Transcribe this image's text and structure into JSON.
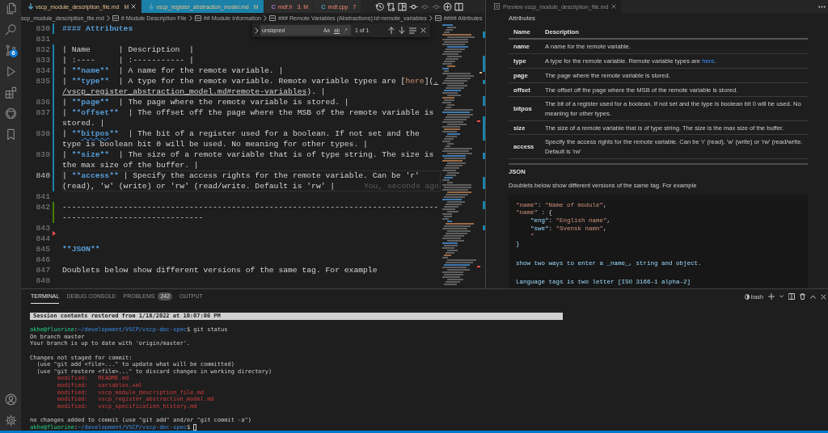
{
  "activity_bar": {
    "source_control_badge": "6"
  },
  "editor": {
    "tabs": [
      {
        "label": "vscp_module_description_file.md",
        "status": "M",
        "kind": "markdown",
        "errors": false,
        "selected": true
      },
      {
        "label": "vscp_register_abstraction_model.md",
        "status": "M",
        "kind": "markdown",
        "errors": false,
        "selected": false
      },
      {
        "label": "mdf.h",
        "status": "3, M",
        "kind": "c_header",
        "icon_text": "C",
        "errors": true,
        "selected": false
      },
      {
        "label": "mdf.cpp",
        "status": "7",
        "kind": "cpp",
        "icon_text": "C",
        "errors": true,
        "selected": false
      }
    ],
    "actions": [
      {
        "disabled": false
      },
      {
        "disabled": false
      },
      {
        "disabled": false
      },
      {
        "disabled": false
      },
      {
        "disabled": true
      },
      {
        "disabled": true
      },
      {
        "disabled": false
      },
      {
        "disabled": false
      }
    ],
    "breadcrumbs": [
      {
        "label": "scp_module_description_file.md",
        "kind": "file"
      },
      {
        "label": "# Module Description File",
        "kind": "symbol"
      },
      {
        "label": "## Module information",
        "kind": "symbol"
      },
      {
        "label": "### Remote Variables (Abstractions):id=remote_variables",
        "kind": "symbol"
      },
      {
        "label": "#### Attributes",
        "kind": "symbol"
      }
    ],
    "find_widget": {
      "query": "unsigned",
      "options": [
        {
          "label": "Aa",
          "kind": "case",
          "on": false
        },
        {
          "label": "ab",
          "kind": "word",
          "on": false
        },
        {
          "label": ".*",
          "kind": "regex",
          "on": false
        }
      ],
      "match_count": "1 of 1"
    },
    "lines": [
      {
        "number": "830",
        "kind": "modified",
        "current": false,
        "wrapped_lines": [
          {
            "spans": [
              {
                "text": "#### Attributes",
                "kind": "heading"
              }
            ]
          }
        ]
      },
      {
        "number": "831",
        "kind": "unchanged",
        "current": false
      },
      {
        "number": "832",
        "kind": "modified",
        "current": false,
        "wrapped_lines": [
          {
            "spans": [
              {
                "text": "| Name      | Description  |",
                "kind": "plain"
              }
            ]
          }
        ]
      },
      {
        "number": "833",
        "kind": "modified",
        "current": false,
        "wrapped_lines": [
          {
            "spans": [
              {
                "text": "| :----     | :----------- |",
                "kind": "plain"
              }
            ]
          }
        ]
      },
      {
        "number": "834",
        "kind": "modified",
        "current": false,
        "wrapped_lines": [
          {
            "spans": [
              {
                "text": "| ",
                "kind": "plain"
              },
              {
                "text": "**name**",
                "kind": "bold"
              },
              {
                "text": "  | A name for the remote variable. |",
                "kind": "plain"
              }
            ]
          }
        ]
      },
      {
        "number": "835",
        "kind": "modified",
        "current": false,
        "wrapped_lines": [
          {
            "spans": [
              {
                "text": "| ",
                "kind": "plain"
              },
              {
                "text": "**type**",
                "kind": "bold"
              },
              {
                "text": "  | A type for the remote variable. Remote variable types are [",
                "kind": "plain"
              },
              {
                "text": "here",
                "kind": "link_text"
              },
              {
                "text": "](",
                "kind": "plain"
              },
              {
                "text": ".",
                "kind": "link_url"
              }
            ]
          },
          {
            "spans": [
              {
                "text": "/vscp_register_abstraction_model.md#remote-variables",
                "kind": "link_url"
              },
              {
                "text": "). |",
                "kind": "plain"
              }
            ]
          }
        ]
      },
      {
        "number": "836",
        "kind": "modified",
        "current": false,
        "wrapped_lines": [
          {
            "spans": [
              {
                "text": "| ",
                "kind": "plain"
              },
              {
                "text": "**page**",
                "kind": "bold"
              },
              {
                "text": "  | The page where the remote variable is stored. |",
                "kind": "plain"
              }
            ]
          }
        ]
      },
      {
        "number": "837",
        "kind": "modified",
        "current": false,
        "wrapped_lines": [
          {
            "spans": [
              {
                "text": "| ",
                "kind": "plain"
              },
              {
                "text": "**offset**",
                "kind": "bold"
              },
              {
                "text": "  | The offset off the page where the MSB of the remote variable is",
                "kind": "plain"
              }
            ]
          },
          {
            "spans": [
              {
                "text": "stored. |",
                "kind": "plain"
              }
            ]
          }
        ]
      },
      {
        "number": "838",
        "kind": "modified",
        "current": false,
        "wrapped_lines": [
          {
            "spans": [
              {
                "text": "| ",
                "kind": "plain"
              },
              {
                "text": "**",
                "kind": "bold"
              },
              {
                "text": "bitpos",
                "kind": "bold_flagged"
              },
              {
                "text": "**",
                "kind": "bold"
              },
              {
                "text": "  | The bit of a register used for a boolean. If not set and the",
                "kind": "plain"
              }
            ]
          },
          {
            "spans": [
              {
                "text": "type is boolean bit 0 will be used. No meaning for other types. |",
                "kind": "plain"
              }
            ]
          }
        ]
      },
      {
        "number": "839",
        "kind": "modified",
        "current": false,
        "wrapped_lines": [
          {
            "spans": [
              {
                "text": "| ",
                "kind": "plain"
              },
              {
                "text": "**size**",
                "kind": "bold"
              },
              {
                "text": "  | The size of a remote variable that is of type string. The size is",
                "kind": "plain"
              }
            ]
          },
          {
            "spans": [
              {
                "text": "the max size of the buffer. |",
                "kind": "plain"
              }
            ]
          }
        ]
      },
      {
        "number": "840",
        "kind": "modified",
        "current": true,
        "blame": "You, seconds ago",
        "wrapped_lines": [
          {
            "spans": [
              {
                "text": "| ",
                "kind": "plain"
              },
              {
                "text": "**access**",
                "kind": "bold"
              },
              {
                "text": " | Specify the access rights for the remote variable. Can be 'r'",
                "kind": "plain"
              }
            ]
          },
          {
            "spans": [
              {
                "text": "(read), 'w' (write) or 'rw' (read/write. Default is 'rw' |",
                "kind": "plain"
              }
            ]
          }
        ]
      },
      {
        "number": "841",
        "kind": "unchanged",
        "current": false
      },
      {
        "number": "842",
        "kind": "added",
        "current": false,
        "wrapped_lines": [
          {
            "spans": [
              {
                "text": "--------------------------------------------------------------------------------",
                "kind": "plain"
              }
            ]
          },
          {
            "spans": [
              {
                "text": "------------------------------",
                "kind": "plain"
              }
            ]
          }
        ]
      },
      {
        "number": "843",
        "kind": "unchanged",
        "current": false
      },
      {
        "number": "844",
        "kind": "deleted",
        "current": false
      },
      {
        "number": "845",
        "kind": "unchanged",
        "current": false,
        "wrapped_lines": [
          {
            "spans": [
              {
                "text": "**JSON**",
                "kind": "bold"
              }
            ]
          }
        ]
      },
      {
        "number": "846",
        "kind": "unchanged",
        "current": false
      },
      {
        "number": "847",
        "kind": "unchanged",
        "current": false,
        "wrapped_lines": [
          {
            "spans": [
              {
                "text": "Doublets below show different versions of the same tag. For example",
                "kind": "plain"
              }
            ]
          }
        ]
      },
      {
        "number": "848",
        "kind": "unchanged",
        "current": false
      }
    ]
  },
  "preview": {
    "tab": {
      "label": "Preview vscp_module_description_file.md"
    },
    "heading": "Attributes",
    "table": {
      "columns": [
        "Name",
        "Description"
      ],
      "rows": [
        {
          "name": "name",
          "description": [
            {
              "text": "A name for the remote variable.",
              "kind": "text"
            }
          ]
        },
        {
          "name": "type",
          "description": [
            {
              "text": "A type for the remote variable. Remote variable types are ",
              "kind": "text"
            },
            {
              "text": "here",
              "kind": "link"
            },
            {
              "text": ".",
              "kind": "text"
            }
          ]
        },
        {
          "name": "page",
          "description": [
            {
              "text": "The page where the remote variable is stored.",
              "kind": "text"
            }
          ]
        },
        {
          "name": "offset",
          "description": [
            {
              "text": "The offset off the page where the MSB of the remote variable is stored.",
              "kind": "text"
            }
          ]
        },
        {
          "name": "bitpos",
          "description": [
            {
              "text": "The bit of a register used for a boolean. If not set and the type is boolean bit 0 will be used. No meaning for other types.",
              "kind": "text"
            }
          ]
        },
        {
          "name": "size",
          "description": [
            {
              "text": "The size of a remote variable that is of type string. The size is the max size of the buffer.",
              "kind": "text"
            }
          ]
        },
        {
          "name": "access",
          "description": [
            {
              "text": "Specify the access rights for the remote variable. Can be 'r' (read), 'w' (write) or 'rw' (read/write. Default is 'rw'",
              "kind": "text"
            }
          ]
        }
      ]
    },
    "subheading": "JSON",
    "paragraph": "Doublets below show different versions of the same tag. For example",
    "code_blocks": [
      {
        "lines": [
          {
            "spans": [
              {
                "text": "\"name\"",
                "kind": "string"
              },
              {
                "text": ": ",
                "kind": "punct"
              },
              {
                "text": "\"Name of module\"",
                "kind": "string"
              },
              {
                "text": ",",
                "kind": "punct"
              }
            ]
          },
          {
            "spans": [
              {
                "text": "\"name\"",
                "kind": "string"
              },
              {
                "text": " : {",
                "kind": "punct"
              }
            ]
          },
          {
            "spans": [
              {
                "text": "    \"eng\"",
                "kind": "attr"
              },
              {
                "text": ": ",
                "kind": "punct"
              },
              {
                "text": "\"English name\"",
                "kind": "string"
              },
              {
                "text": ",",
                "kind": "punct"
              }
            ]
          },
          {
            "spans": [
              {
                "text": "    \"swe\"",
                "kind": "attr"
              },
              {
                "text": ": ",
                "kind": "punct"
              },
              {
                "text": "\"Svensk namn\"",
                "kind": "string"
              },
              {
                "text": ",",
                "kind": "punct"
              }
            ]
          },
          {
            "spans": [
              {
                "text": "    \"",
                "kind": "string"
              }
            ]
          },
          {
            "spans": [
              {
                "text": "}",
                "kind": "attr"
              }
            ]
          }
        ]
      },
      {
        "lines": [
          {
            "spans": [
              {
                "text": "show two ways to enter a _name_, string and object.",
                "kind": "attr"
              }
            ]
          }
        ]
      },
      {
        "lines": [
          {
            "spans": [
              {
                "text": "Language tags is two letter [ISO 3166-1 alpha-2]",
                "kind": "attr"
              }
            ]
          }
        ]
      }
    ]
  },
  "panel": {
    "tabs": [
      {
        "label": "TERMINAL",
        "selected": true
      },
      {
        "label": "DEBUG CONSOLE",
        "selected": false
      },
      {
        "label": "PROBLEMS",
        "badge": "242",
        "selected": false
      },
      {
        "label": "OUTPUT",
        "selected": false
      }
    ],
    "terminal_name": "bash",
    "terminal": [
      {
        "lines": [
          {
            "spans": [
              {
                "text": "Session contents restored from 1/18/2022 at 10:07:06 PM",
                "kind": "banner"
              }
            ]
          }
        ]
      },
      {
        "lines": [
          {
            "spans": [
              {
                "text": "akhe@fluorine",
                "kind": "user"
              },
              {
                "text": ":",
                "kind": "plain"
              },
              {
                "text": "~/development/VSCP/vscp-doc-spec",
                "kind": "path"
              },
              {
                "text": "$ git status",
                "kind": "plain"
              }
            ]
          },
          {
            "spans": [
              {
                "text": "On branch master",
                "kind": "plain"
              }
            ]
          },
          {
            "spans": [
              {
                "text": "Your branch is up to date with 'origin/master'.",
                "kind": "plain"
              }
            ]
          }
        ]
      },
      {
        "lines": [
          {
            "spans": [
              {
                "text": "Changes not staged for commit:",
                "kind": "plain"
              }
            ]
          },
          {
            "spans": [
              {
                "text": "  (use \"git add <file>...\" to update what will be committed)",
                "kind": "plain"
              }
            ]
          },
          {
            "spans": [
              {
                "text": "  (use \"git restore <file>...\" to discard changes in working directory)",
                "kind": "plain"
              }
            ]
          },
          {
            "spans": [
              {
                "text": "        modified:   README.md",
                "kind": "modified"
              }
            ]
          },
          {
            "spans": [
              {
                "text": "        modified:   variables.xml",
                "kind": "modified"
              }
            ]
          },
          {
            "spans": [
              {
                "text": "        modified:   vscp_module_description_file.md",
                "kind": "modified"
              }
            ]
          },
          {
            "spans": [
              {
                "text": "        modified:   vscp_register_abstraction_model.md",
                "kind": "modified"
              }
            ]
          },
          {
            "spans": [
              {
                "text": "        modified:   vscp_specification_history.md",
                "kind": "modified"
              }
            ]
          }
        ]
      },
      {
        "lines": [
          {
            "spans": [
              {
                "text": "no changes added to commit (use \"git add\" and/or \"git commit -a\")",
                "kind": "plain"
              }
            ]
          },
          {
            "spans": [
              {
                "text": "akhe@fluorine",
                "kind": "user"
              },
              {
                "text": ":",
                "kind": "plain"
              },
              {
                "text": "~/development/VSCP/vscp-doc-spec",
                "kind": "path"
              },
              {
                "text": "$ ",
                "kind": "plain"
              },
              {
                "kind": "cursor"
              }
            ]
          }
        ]
      }
    ]
  }
}
